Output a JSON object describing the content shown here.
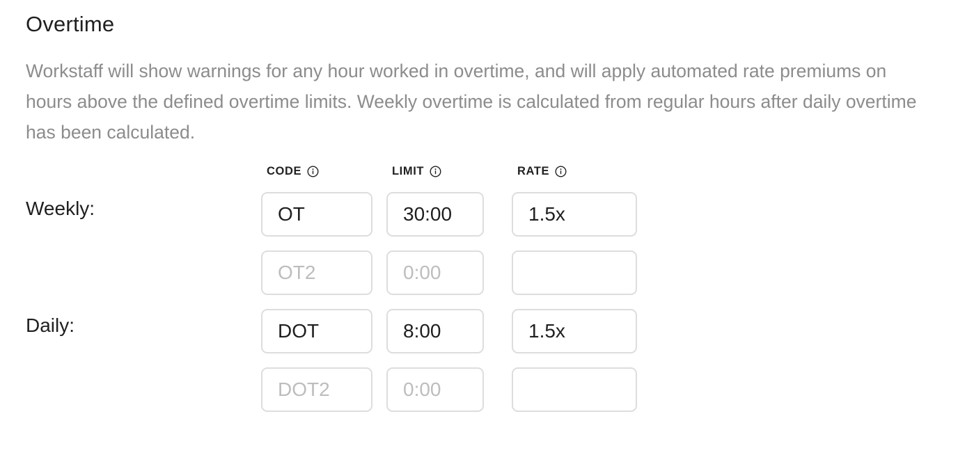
{
  "section": {
    "title": "Overtime",
    "description": "Workstaff will show warnings for any hour worked in overtime, and will apply automated rate premiums on hours above the defined overtime limits. Weekly overtime is calculated from regular hours after daily overtime has been calculated."
  },
  "columns": {
    "code": {
      "label": "CODE",
      "icon": "info-icon"
    },
    "limit": {
      "label": "LIMIT",
      "icon": "info-icon"
    },
    "rate": {
      "label": "RATE",
      "icon": "info-icon"
    }
  },
  "weekly": {
    "label": "Weekly:",
    "primary": {
      "code": "OT",
      "limit": "30:00",
      "rate": "1.5x"
    },
    "secondary": {
      "code": "",
      "code_placeholder": "OT2",
      "limit": "",
      "limit_placeholder": "0:00",
      "rate": "",
      "rate_placeholder": ""
    }
  },
  "daily": {
    "label": "Daily:",
    "primary": {
      "code": "DOT",
      "limit": "8:00",
      "rate": "1.5x"
    },
    "secondary": {
      "code": "",
      "code_placeholder": "DOT2",
      "limit": "",
      "limit_placeholder": "0:00",
      "rate": "",
      "rate_placeholder": ""
    }
  }
}
